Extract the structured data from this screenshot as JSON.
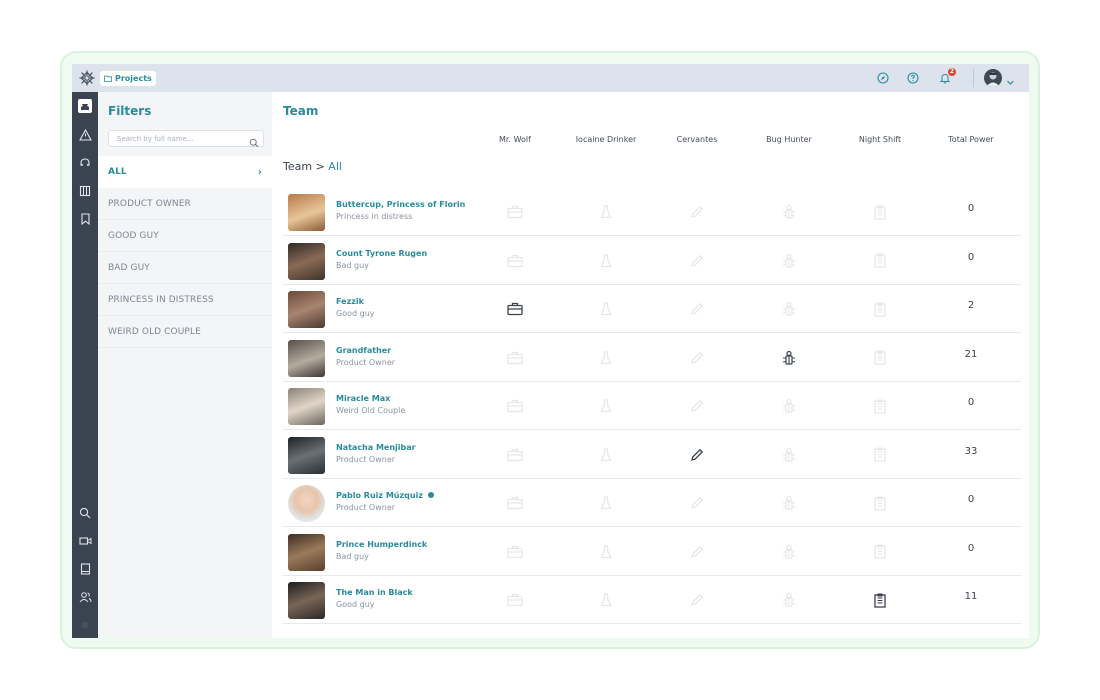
{
  "topbar": {
    "breadcrumb_label": "Projects",
    "notification_count": "2",
    "icons": [
      "compass-icon",
      "help-icon",
      "bell-icon",
      "user-avatar",
      "chevron-down-icon"
    ]
  },
  "rail": {
    "icons": [
      "hacker-icon",
      "alert-triangle-icon",
      "headset-icon",
      "columns-icon",
      "bookmark-icon",
      "search-icon",
      "video-icon",
      "book-icon",
      "users-icon",
      "status-dot-icon"
    ]
  },
  "filters": {
    "title": "Filters",
    "search_placeholder": "Search by full name...",
    "items": [
      {
        "label": "ALL",
        "active": true
      },
      {
        "label": "PRODUCT OWNER",
        "active": false
      },
      {
        "label": "GOOD GUY",
        "active": false
      },
      {
        "label": "BAD GUY",
        "active": false
      },
      {
        "label": "PRINCESS IN DISTRESS",
        "active": false
      },
      {
        "label": "WEIRD OLD COUPLE",
        "active": false
      }
    ]
  },
  "main": {
    "title": "Team",
    "breadcrumb_root": "Team",
    "breadcrumb_sep": " > ",
    "breadcrumb_current": "All",
    "columns": [
      "Mr. Wolf",
      "Iocaine Drinker",
      "Cervantes",
      "Bug Hunter",
      "Night Shift",
      "Total Power"
    ],
    "column_icons": [
      "briefcase-icon",
      "flask-icon",
      "pencil-icon",
      "bug-icon",
      "clipboard-icon"
    ],
    "members": [
      {
        "name": "Buttercup, Princess of Florin",
        "role": "Princess in distress",
        "badges": [
          false,
          false,
          false,
          false,
          false
        ],
        "power": "0",
        "online": false
      },
      {
        "name": "Count Tyrone Rugen",
        "role": "Bad guy",
        "badges": [
          false,
          false,
          false,
          false,
          false
        ],
        "power": "0",
        "online": false
      },
      {
        "name": "Fezzik",
        "role": "Good guy",
        "badges": [
          true,
          false,
          false,
          false,
          false
        ],
        "power": "2",
        "online": false
      },
      {
        "name": "Grandfather",
        "role": "Product Owner",
        "badges": [
          false,
          false,
          false,
          true,
          false
        ],
        "power": "21",
        "online": false
      },
      {
        "name": "Miracle Max",
        "role": "Weird Old Couple",
        "badges": [
          false,
          false,
          false,
          false,
          false
        ],
        "power": "0",
        "online": false
      },
      {
        "name": "Natacha Menjibar",
        "role": "Product Owner",
        "badges": [
          false,
          false,
          true,
          false,
          false
        ],
        "power": "33",
        "online": false
      },
      {
        "name": "Pablo Ruiz Múzquiz",
        "role": "Product Owner",
        "badges": [
          false,
          false,
          false,
          false,
          false
        ],
        "power": "0",
        "online": true
      },
      {
        "name": "Prince Humperdinck",
        "role": "Bad guy",
        "badges": [
          false,
          false,
          false,
          false,
          false
        ],
        "power": "0",
        "online": false
      },
      {
        "name": "The Man in Black",
        "role": "Good guy",
        "badges": [
          false,
          false,
          false,
          false,
          true
        ],
        "power": "11",
        "online": false
      }
    ]
  },
  "colors": {
    "accent": "#2a8b9b",
    "rail": "#3a4450",
    "topbar": "#dde3ec",
    "notification": "#e0412b"
  }
}
